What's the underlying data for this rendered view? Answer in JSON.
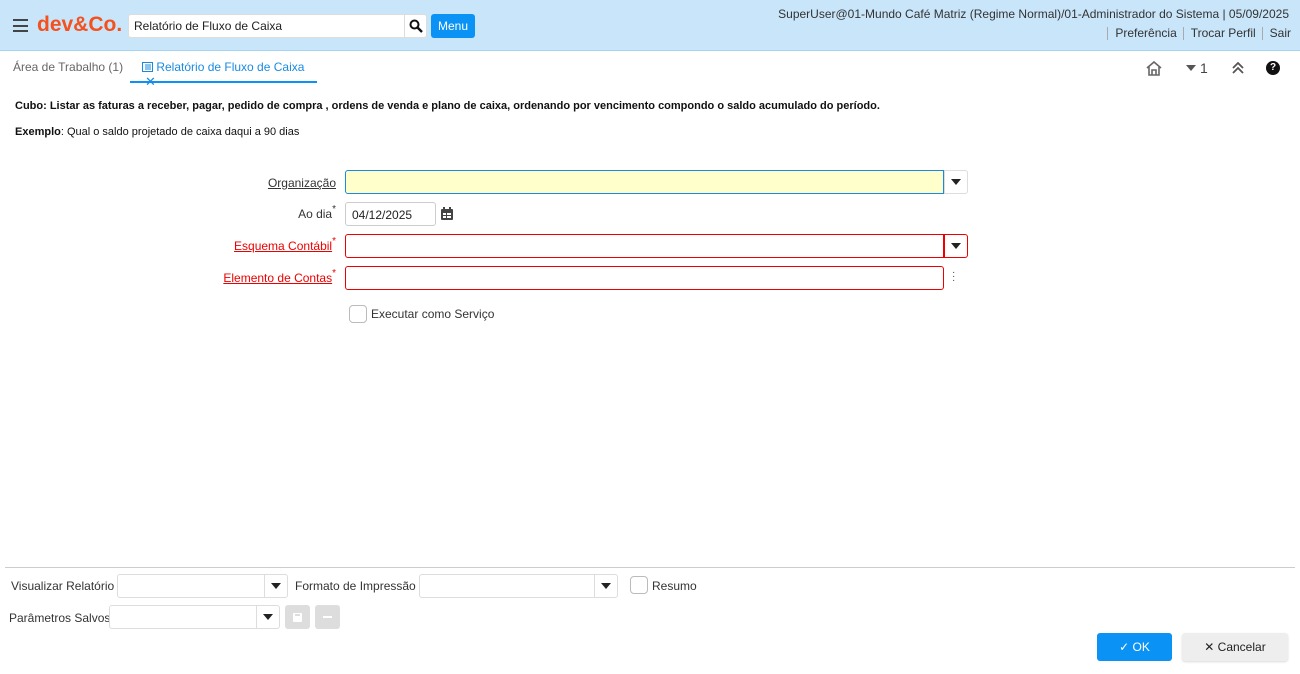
{
  "header": {
    "logo": "dev&Co.",
    "search_value": "Relatório de Fluxo de Caixa",
    "menu_label": "Menu",
    "user_info": "SuperUser@01-Mundo Café Matriz (Regime Normal)/01-Administrador do Sistema | 05/09/2025",
    "links": [
      "Preferência",
      "Trocar Perfil",
      "Sair"
    ]
  },
  "tabs": {
    "workspace": "Área de Trabalho (1)",
    "active": "Relatório de Fluxo de Caixa",
    "window_count": "1"
  },
  "description": {
    "cubo_label": "Cubo:",
    "cubo_text": " Listar as faturas a receber, pagar, pedido de compra , ordens de venda e plano de caixa, ordenando por vencimento compondo o saldo acumulado do período.",
    "exemplo_label": "Exemplo",
    "exemplo_text": ": Qual o saldo projetado de caixa daqui a 90 dias"
  },
  "form": {
    "organizacao": {
      "label": "Organização",
      "value": ""
    },
    "ao_dia": {
      "label": "Ao dia",
      "value": "04/12/2025"
    },
    "esquema": {
      "label": "Esquema Contábil",
      "value": ""
    },
    "elemento": {
      "label": "Elemento de Contas",
      "value": ""
    },
    "executar": {
      "label": "Executar como Serviço",
      "checked": false
    },
    "required_mark": "*"
  },
  "footer": {
    "visualizar_label": "Visualizar Relatório",
    "formato_label": "Formato de Impressão",
    "resumo_label": "Resumo",
    "parametros_label": "Parâmetros Salvos",
    "ok_label": "OK",
    "cancel_label": "Cancelar"
  },
  "colors": {
    "accent": "#0a93f5",
    "brand": "#f4511e",
    "header_bg": "#c8e5fa",
    "required": "#e00000",
    "mandatory_bg": "#ffffcc"
  }
}
